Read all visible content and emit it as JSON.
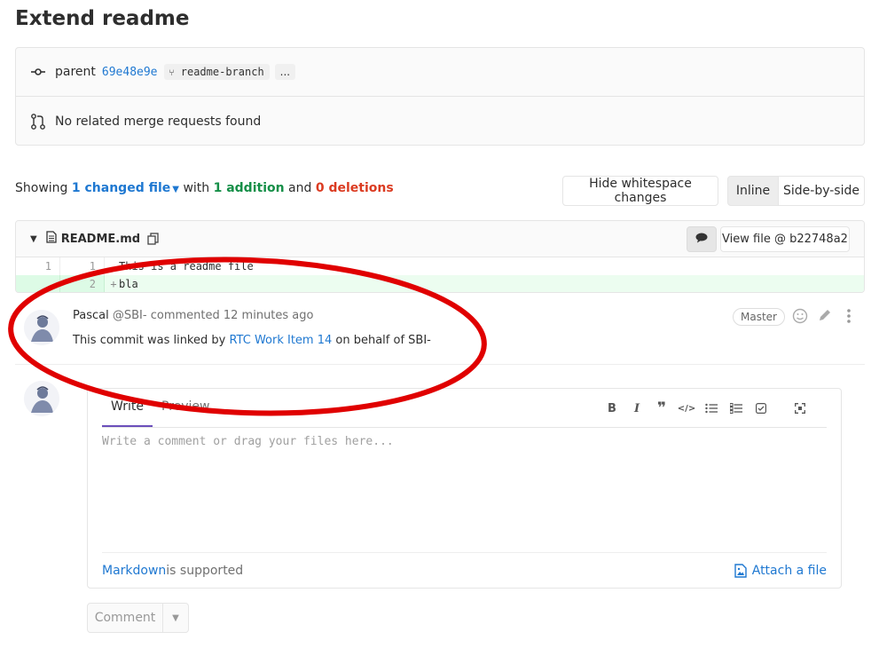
{
  "page": {
    "title": "Extend readme"
  },
  "commit_info": {
    "parent_label": "parent",
    "parent_sha": "69e48e9e",
    "branch": "readme-branch",
    "more": "...",
    "merge_requests_text": "No related merge requests found"
  },
  "diff_stats": {
    "showing": "Showing",
    "changed_files": "1 changed file",
    "with": "with",
    "additions": "1 addition",
    "and": "and",
    "deletions": "0 deletions"
  },
  "view_options": {
    "hide_whitespace": "Hide whitespace changes",
    "inline": "Inline",
    "side_by_side": "Side-by-side"
  },
  "file": {
    "name": "README.md",
    "view_file": "View file @ b22748a2",
    "lines": [
      {
        "old": "1",
        "new": "1",
        "sign": "",
        "code": "This is a readme file",
        "type": "context"
      },
      {
        "old": "",
        "new": "2",
        "sign": "+",
        "code": "bla",
        "type": "add"
      }
    ]
  },
  "note": {
    "author_name": "Pascal",
    "author_handle": "@SBI-",
    "action": "commented",
    "time": "12 minutes ago",
    "role": "Master",
    "body_prefix": "This commit was linked by ",
    "body_link": "RTC Work Item 14",
    "body_suffix": " on behalf of SBI-"
  },
  "comment_form": {
    "tab_write": "Write",
    "tab_preview": "Preview",
    "placeholder": "Write a comment or drag your files here...",
    "markdown_link": "Markdown",
    "markdown_suffix": " is supported",
    "attach": "Attach a file",
    "submit": "Comment"
  },
  "toolbar_icons": [
    "bold-icon",
    "italic-icon",
    "quote-icon",
    "code-icon",
    "bullet-list-icon",
    "numbered-list-icon",
    "task-list-icon",
    "fullscreen-icon"
  ],
  "colors": {
    "link": "#1f78d1",
    "addition": "#168f48",
    "deletion": "#db3b21",
    "annotation": "#e00000"
  }
}
